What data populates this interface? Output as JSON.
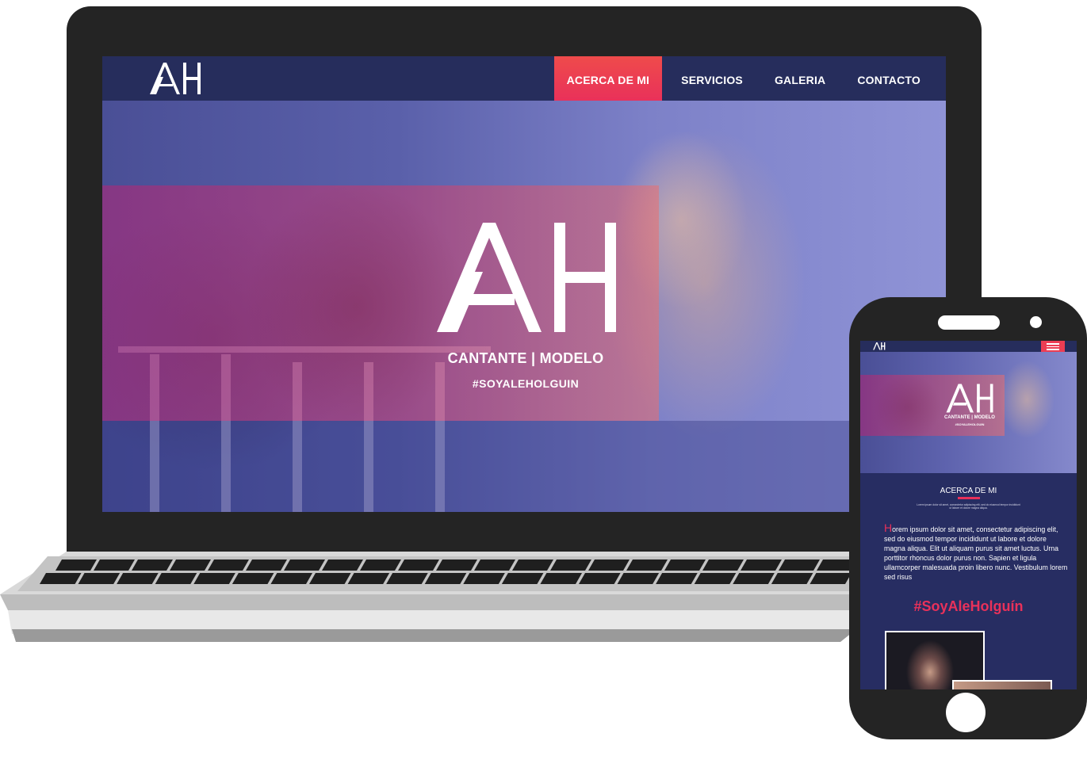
{
  "desktop": {
    "nav": {
      "logo": "AH",
      "items": [
        {
          "label": "ACERCA DE MI",
          "active": true
        },
        {
          "label": "SERVICIOS",
          "active": false
        },
        {
          "label": "GALERIA",
          "active": false
        },
        {
          "label": "CONTACTO",
          "active": false
        }
      ]
    },
    "hero": {
      "logo": "AH",
      "tagline": "CANTANTE | MODELO",
      "hashtag": "#SOYALEHOLGUIN"
    }
  },
  "mobile": {
    "nav": {
      "logo": "AH",
      "menu_icon": "hamburger-icon"
    },
    "hero": {
      "logo": "AH",
      "tagline": "CANTANTE | MODELO",
      "hashtag": "#SOYALEHOLGUIN"
    },
    "about": {
      "title": "ACERCA DE MI",
      "intro": "Lorem ipsum dolor sit amet, consectetur adipiscing elit, sed do eiusmod tempor incididunt ut labore et dolore magna aliqua.",
      "dropcap": "H",
      "body": "orem ipsum dolor sit amet, consectetur adipiscing elit, sed do eiusmod tempor incididunt ut labore et dolore magna aliqua. Elit ut aliquam purus sit amet luctus. Urna porttitor rhoncus dolor purus non. Sapien et ligula ullamcorper malesuada proin libero nunc. Vestibulum lorem sed risus",
      "hashtag": "#SoyAleHolguín"
    }
  },
  "colors": {
    "navy": "#262d5c",
    "accent": "#e9315a",
    "active_nav": "#ef4b4b",
    "device_frame": "#242424"
  }
}
